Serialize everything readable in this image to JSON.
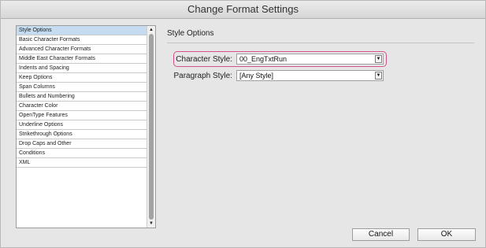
{
  "window": {
    "title": "Change Format Settings"
  },
  "sidebar": {
    "items": [
      {
        "label": "Style Options",
        "selected": true
      },
      {
        "label": "Basic Character Formats"
      },
      {
        "label": "Advanced Character Formats"
      },
      {
        "label": "Middle East Character Formats"
      },
      {
        "label": "Indents and Spacing"
      },
      {
        "label": "Keep Options"
      },
      {
        "label": "Span Columns"
      },
      {
        "label": "Bullets and Numbering"
      },
      {
        "label": "Character Color"
      },
      {
        "label": "OpenType Features"
      },
      {
        "label": "Underline Options"
      },
      {
        "label": "Strikethrough Options"
      },
      {
        "label": "Drop Caps and Other"
      },
      {
        "label": "Conditions"
      },
      {
        "label": "XML"
      }
    ]
  },
  "main": {
    "section_title": "Style Options",
    "character_style": {
      "label": "Character Style:",
      "value": "00_EngTxtRun"
    },
    "paragraph_style": {
      "label": "Paragraph Style:",
      "value": "[Any Style]"
    }
  },
  "buttons": {
    "cancel": "Cancel",
    "ok": "OK"
  },
  "icons": {
    "dropdown": "chevron-down-icon",
    "scroll_up": "arrow-up-icon",
    "scroll_down": "arrow-down-icon"
  },
  "colors": {
    "highlight": "#d2538a",
    "selection": "#c5dbef"
  }
}
